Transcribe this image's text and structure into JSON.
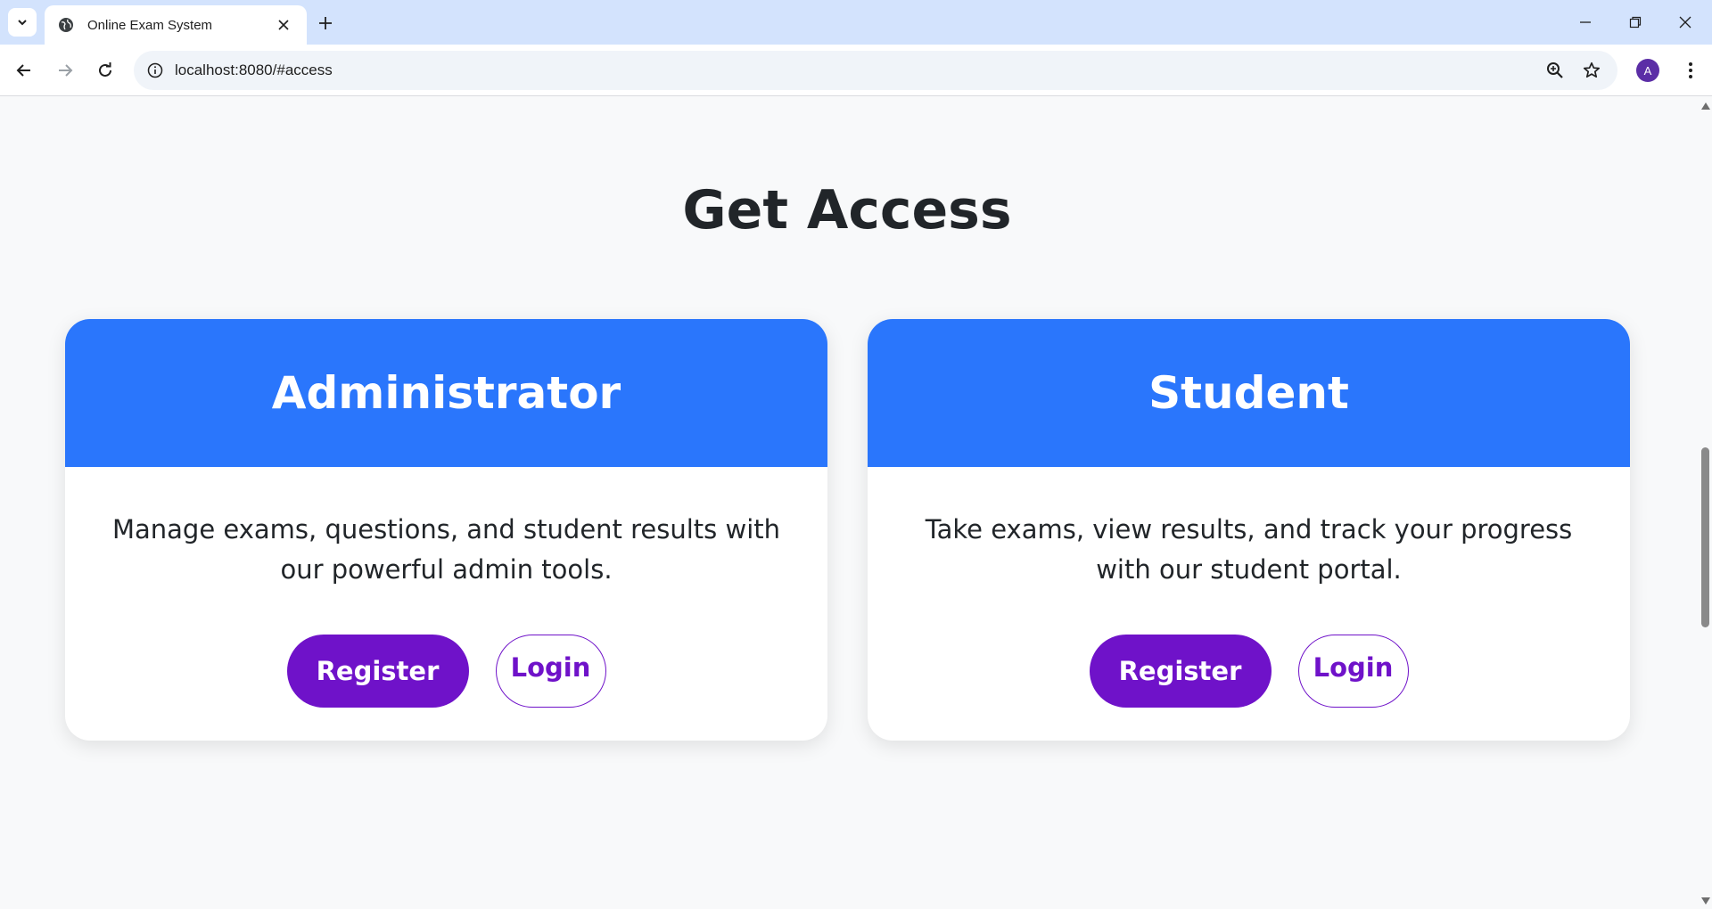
{
  "browser": {
    "tab_title": "Online Exam System",
    "url": "localhost:8080/#access",
    "profile_initial": "A"
  },
  "page": {
    "section_title": "Get Access"
  },
  "cards": [
    {
      "title": "Administrator",
      "description": "Manage exams, questions, and student results with our powerful admin tools.",
      "register_label": "Register",
      "login_label": "Login"
    },
    {
      "title": "Student",
      "description": "Take exams, view results, and track your progress with our student portal.",
      "register_label": "Register",
      "login_label": "Login"
    }
  ],
  "colors": {
    "card_header": "#2a76fc",
    "primary_button": "#6f12c9",
    "page_background": "#f8f9fa"
  }
}
